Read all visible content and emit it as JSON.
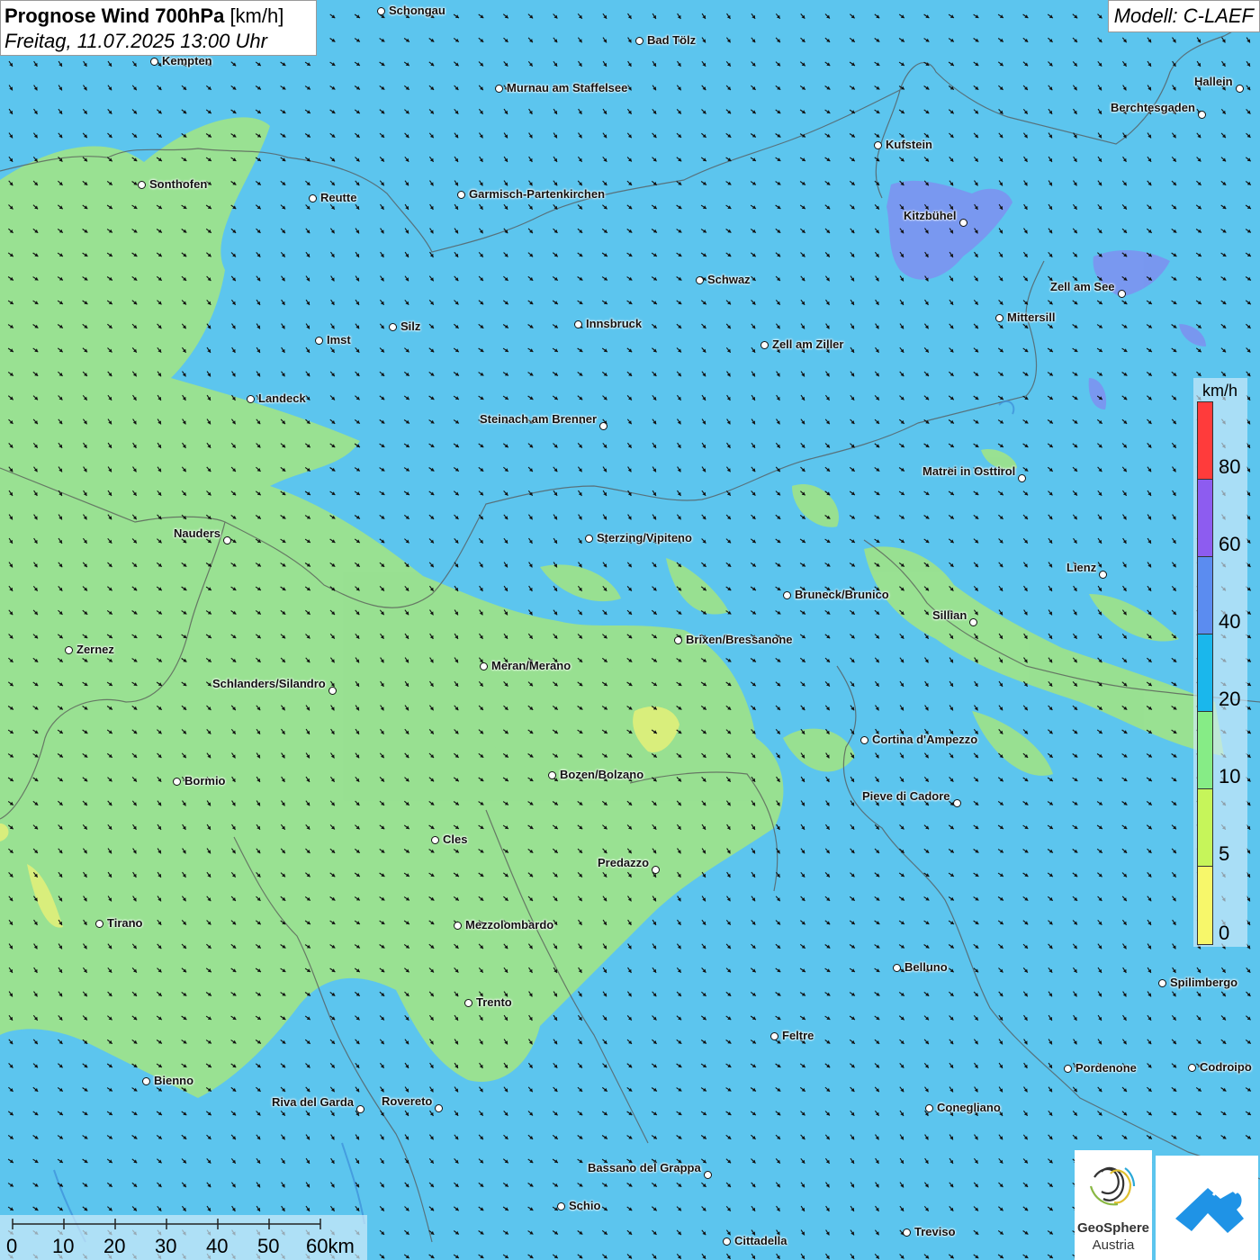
{
  "header": {
    "title_bold": "Prognose Wind 700hPa",
    "title_unit": "[km/h]",
    "datetime": "Freitag, 11.07.2025 13:00 Uhr"
  },
  "model": "Modell: C-LAEF",
  "legend": {
    "unit": "km/h",
    "labels": [
      "80",
      "60",
      "40",
      "20",
      "10",
      "5",
      "0"
    ],
    "colors": [
      "#ff3b3b",
      "#8d5cf0",
      "#5b8cf0",
      "#1ab7ec",
      "#86ec86",
      "#c6f55a",
      "#f7f76a"
    ]
  },
  "scalebar": {
    "labels": [
      "0",
      "10",
      "20",
      "30",
      "40",
      "50",
      "60km"
    ]
  },
  "logo": {
    "name": "GeoSphere",
    "country": "Austria"
  },
  "cities": [
    {
      "name": "Schongau"
    },
    {
      "name": "Bad Tölz"
    },
    {
      "name": "Kempten"
    },
    {
      "name": "Murnau am Staffelsee"
    },
    {
      "name": "Hallein"
    },
    {
      "name": "Berchtesgaden"
    },
    {
      "name": "Kufstein"
    },
    {
      "name": "Sonthofen"
    },
    {
      "name": "Reutte"
    },
    {
      "name": "Garmisch-Partenkirchen"
    },
    {
      "name": "Kitzbühel"
    },
    {
      "name": "Schwaz"
    },
    {
      "name": "Zell am See"
    },
    {
      "name": "Mittersill"
    },
    {
      "name": "Innsbruck"
    },
    {
      "name": "Silz"
    },
    {
      "name": "Imst"
    },
    {
      "name": "Zell am Ziller"
    },
    {
      "name": "Landeck"
    },
    {
      "name": "Steinach am Brenner"
    },
    {
      "name": "Matrei in Osttirol"
    },
    {
      "name": "Nauders"
    },
    {
      "name": "Sterzing/Vipiteno"
    },
    {
      "name": "Lienz"
    },
    {
      "name": "Bruneck/Brunico"
    },
    {
      "name": "Sillian"
    },
    {
      "name": "Brixen/Bressanone"
    },
    {
      "name": "Zernez"
    },
    {
      "name": "Meran/Merano"
    },
    {
      "name": "Schlanders/Silandro"
    },
    {
      "name": "Cortina d'Ampezzo"
    },
    {
      "name": "Bozen/Bolzano"
    },
    {
      "name": "Bormio"
    },
    {
      "name": "Pieve di Cadore"
    },
    {
      "name": "Cles"
    },
    {
      "name": "Predazzo"
    },
    {
      "name": "Tirano"
    },
    {
      "name": "Mezzolombardo"
    },
    {
      "name": "Belluno"
    },
    {
      "name": "Spilimbergo"
    },
    {
      "name": "Trento"
    },
    {
      "name": "Feltre"
    },
    {
      "name": "Pordenone"
    },
    {
      "name": "Codroipo"
    },
    {
      "name": "Bienno"
    },
    {
      "name": "Riva del Garda"
    },
    {
      "name": "Rovereto"
    },
    {
      "name": "Conegliano"
    },
    {
      "name": "Bassano del Grappa"
    },
    {
      "name": "Schio"
    },
    {
      "name": "Treviso"
    },
    {
      "name": "Cittadella"
    }
  ]
}
